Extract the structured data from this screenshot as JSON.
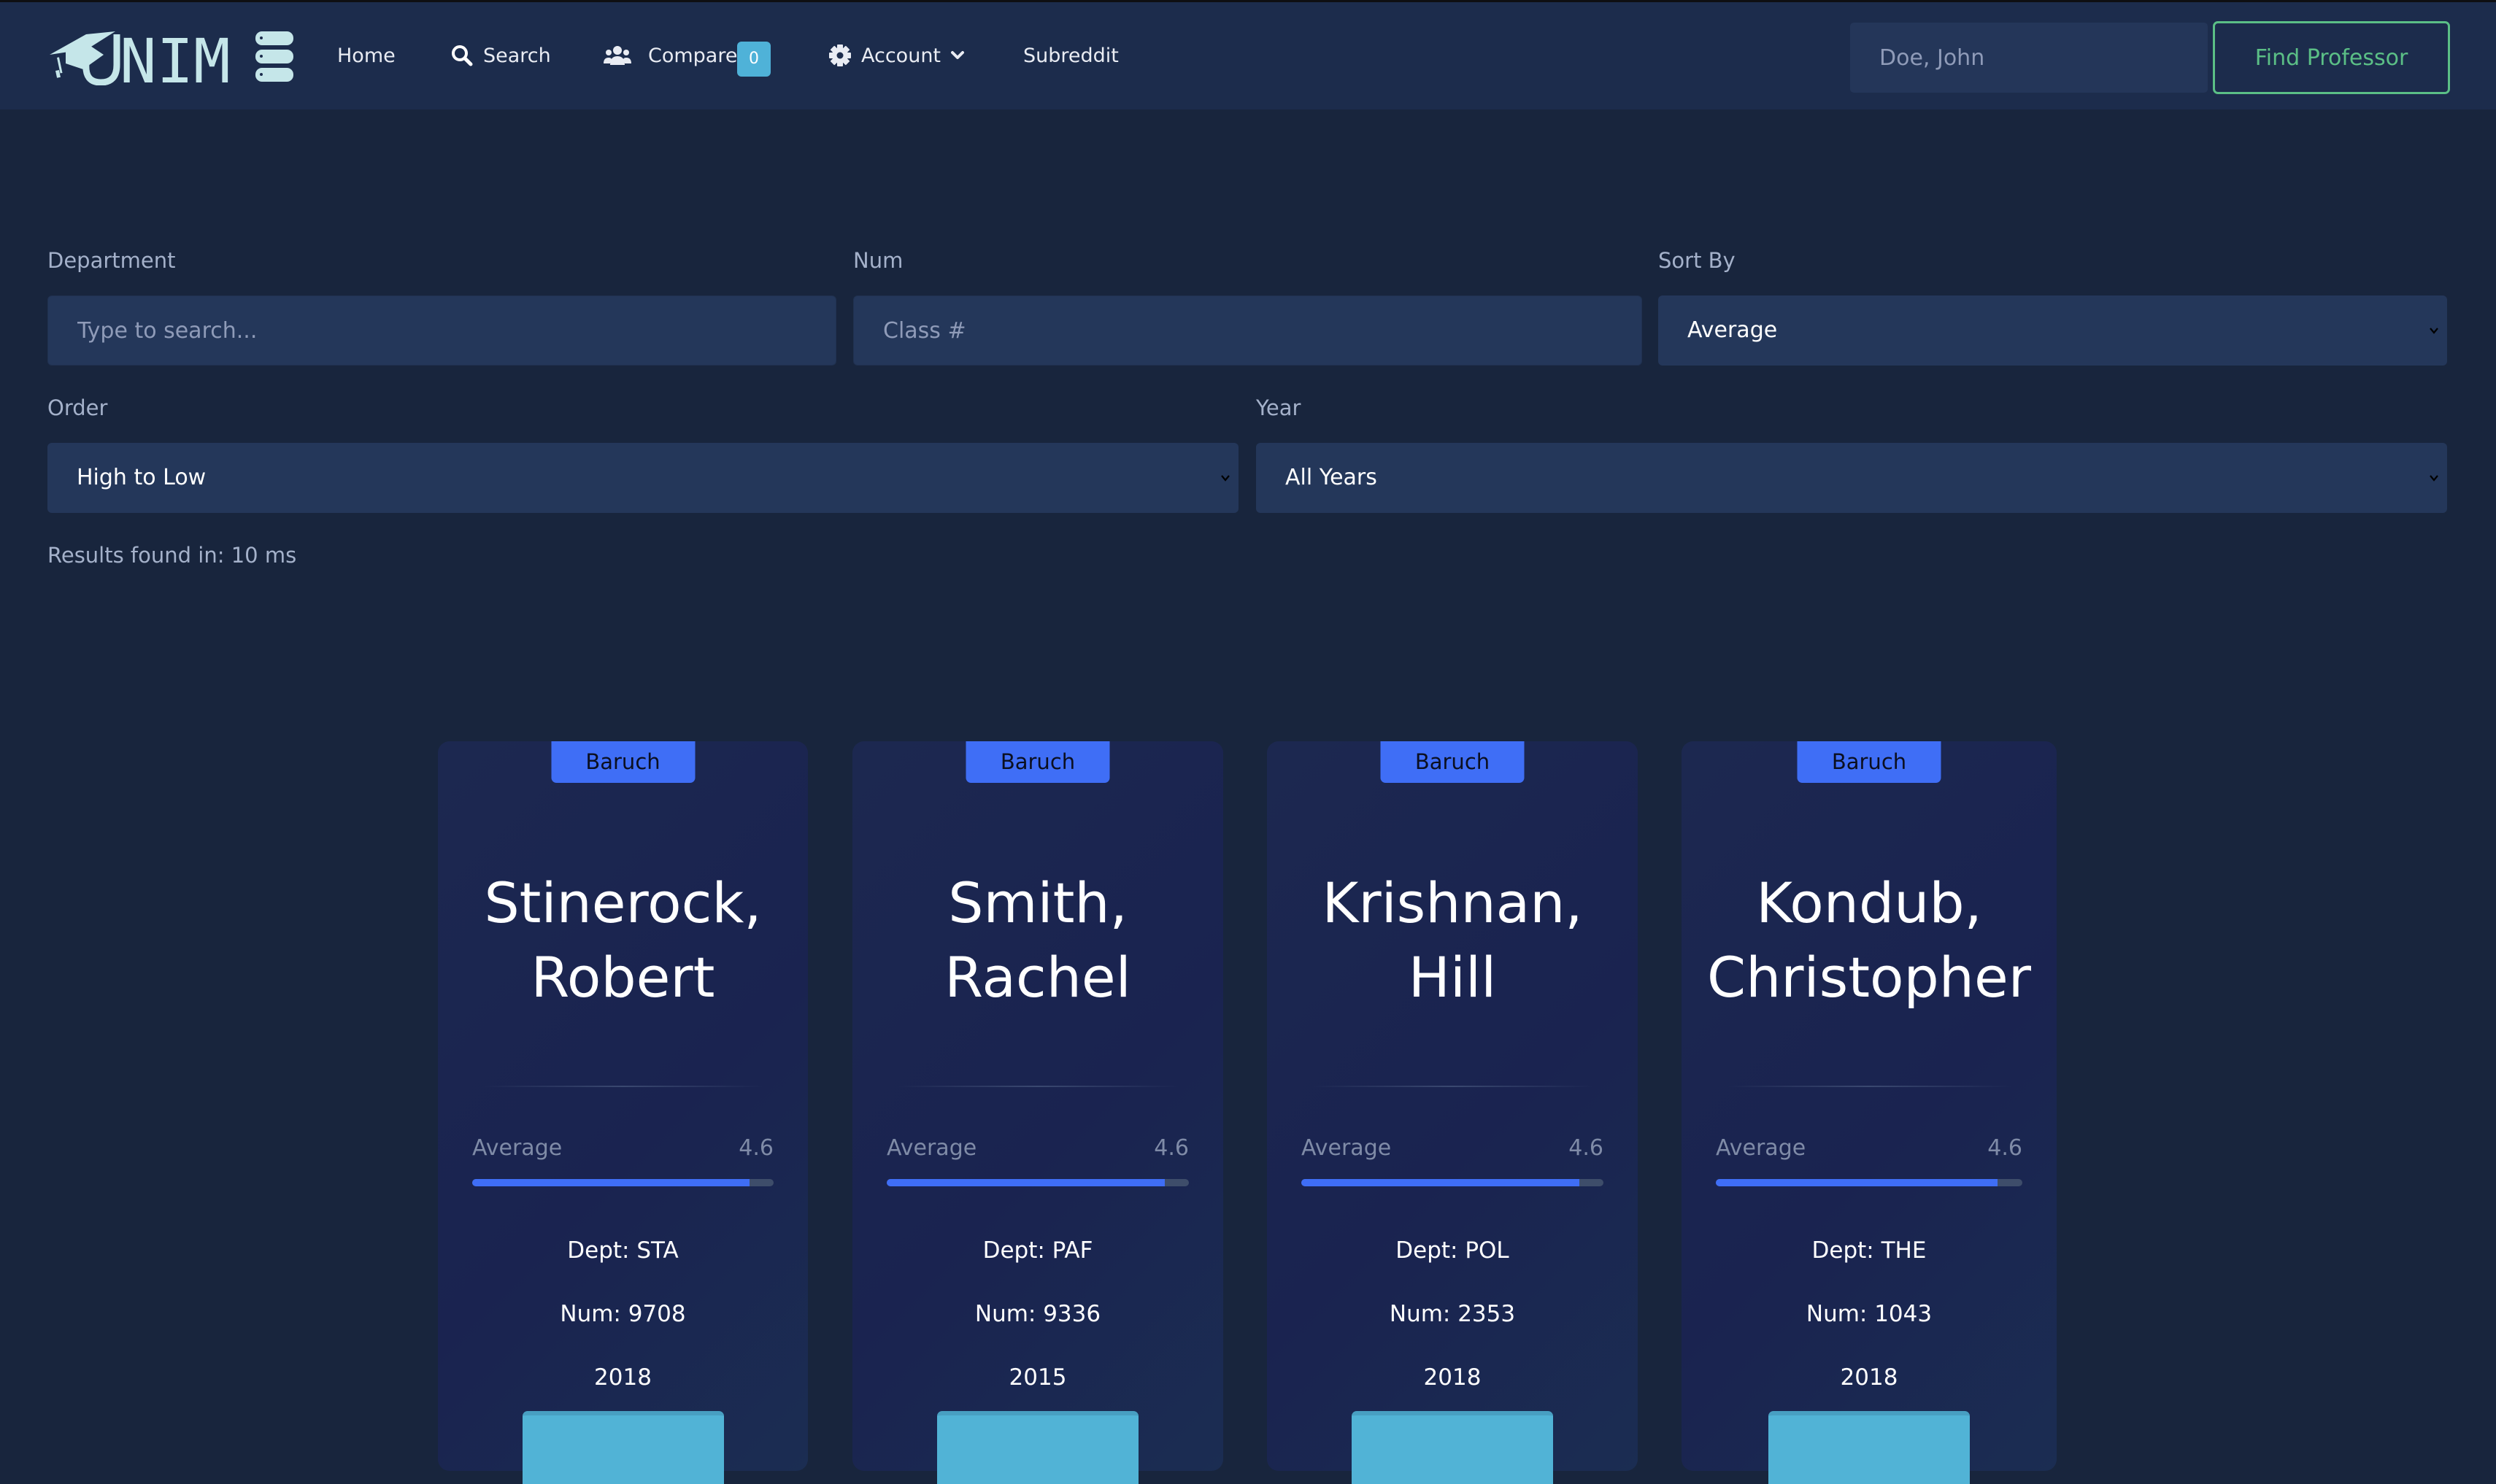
{
  "nav": {
    "logo_text": "UNIME",
    "links": [
      {
        "label": "Home",
        "icon": null
      },
      {
        "label": "Search",
        "icon": "search-icon"
      },
      {
        "label": "Compare",
        "icon": "users-icon",
        "badge": "0"
      },
      {
        "label": "Account",
        "icon": "gear-icon",
        "dropdown": true
      },
      {
        "label": "Subreddit",
        "icon": null
      }
    ],
    "search_placeholder": "Doe, John",
    "search_value": "",
    "find_button": "Find Professor"
  },
  "filters": {
    "department": {
      "label": "Department",
      "placeholder": "Type to search...",
      "value": ""
    },
    "num": {
      "label": "Num",
      "placeholder": "Class #",
      "value": ""
    },
    "sort_by": {
      "label": "Sort By",
      "value": "Average"
    },
    "order": {
      "label": "Order",
      "value": "High to Low"
    },
    "year": {
      "label": "Year",
      "value": "All Years"
    }
  },
  "results_text": "Results found in: 10 ms",
  "colors": {
    "accent": "#3f6ef6",
    "success": "#5bbf86",
    "info": "#51b3d6",
    "background": "#18253d",
    "navbar": "#1c2c4c"
  },
  "cards": [
    {
      "school": "Baruch",
      "name_line1": "Stinerock,",
      "name_line2": "Robert",
      "stat_label": "Average",
      "stat_value": "4.6",
      "stat_fraction": 0.92,
      "dept": "Dept: STA",
      "num": "Num: 9708",
      "year": "2018"
    },
    {
      "school": "Baruch",
      "name_line1": "Smith,",
      "name_line2": "Rachel",
      "stat_label": "Average",
      "stat_value": "4.6",
      "stat_fraction": 0.92,
      "dept": "Dept: PAF",
      "num": "Num: 9336",
      "year": "2015"
    },
    {
      "school": "Baruch",
      "name_line1": "Krishnan,",
      "name_line2": "Hill",
      "stat_label": "Average",
      "stat_value": "4.6",
      "stat_fraction": 0.92,
      "dept": "Dept: POL",
      "num": "Num: 2353",
      "year": "2018"
    },
    {
      "school": "Baruch",
      "name_line1": "Kondub,",
      "name_line2": "Christopher",
      "stat_label": "Average",
      "stat_value": "4.6",
      "stat_fraction": 0.92,
      "dept": "Dept: THE",
      "num": "Num: 1043",
      "year": "2018"
    }
  ]
}
